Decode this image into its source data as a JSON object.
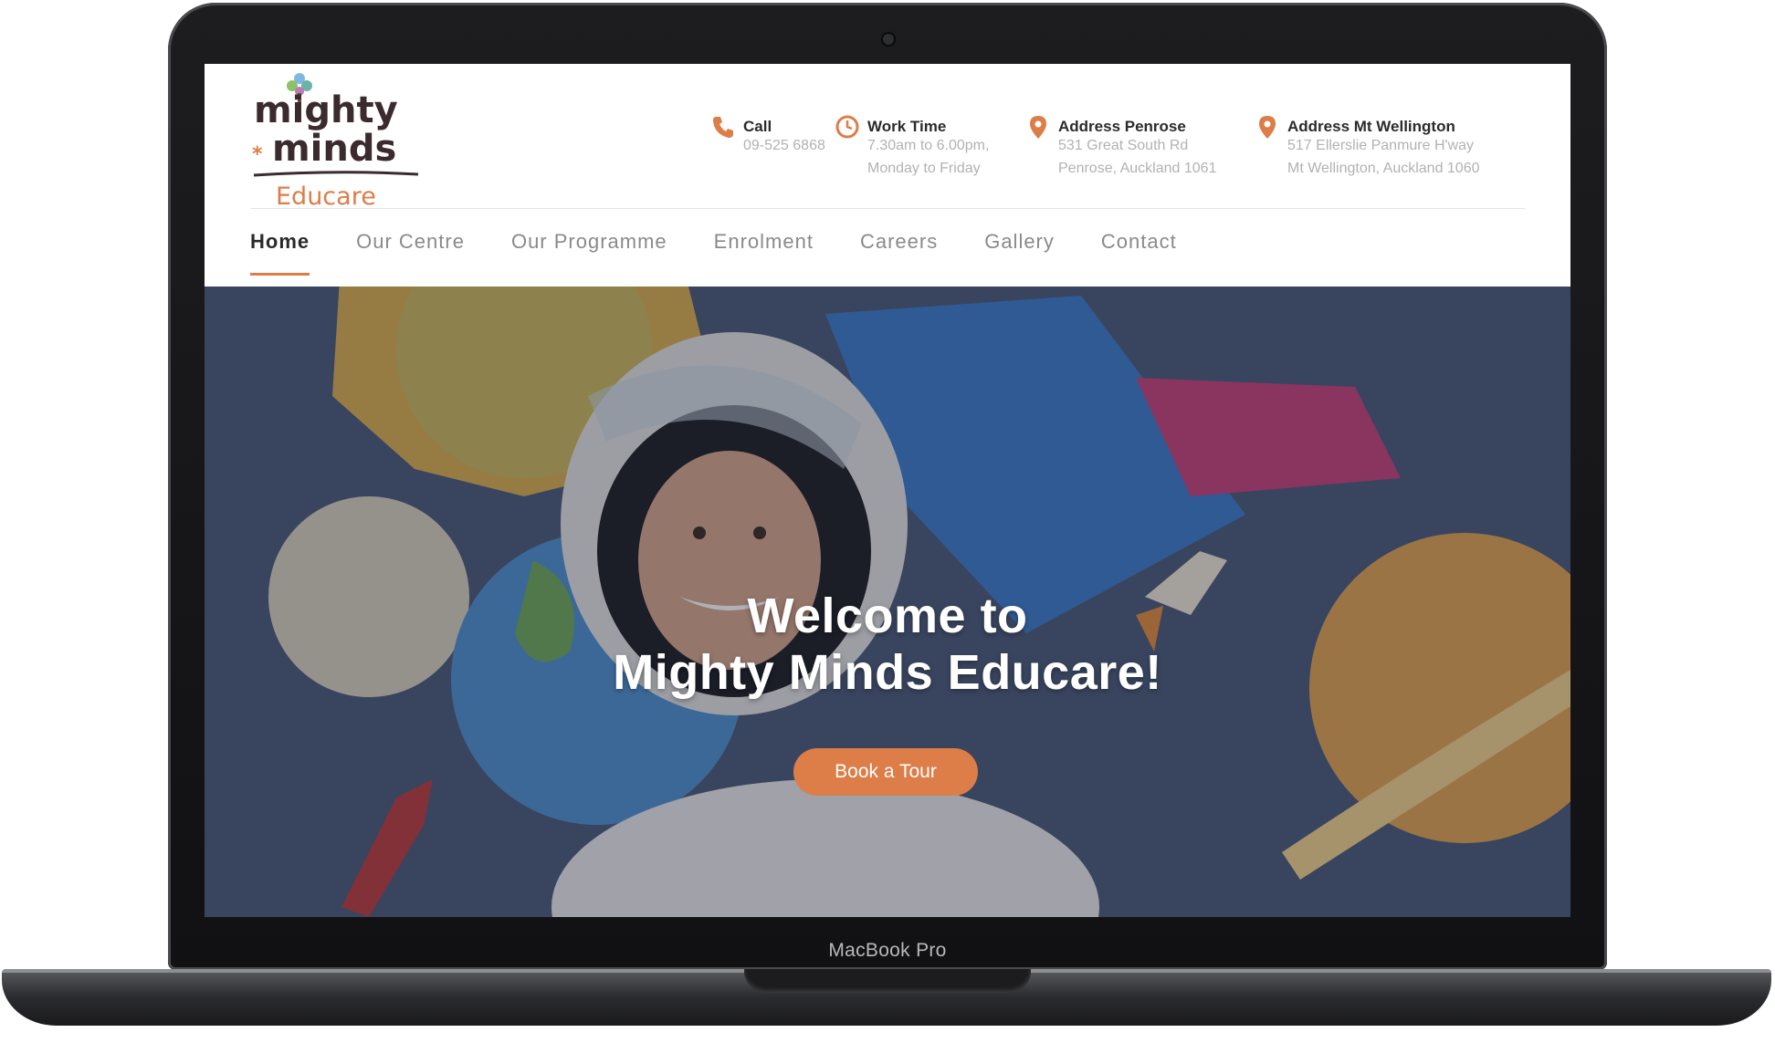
{
  "device": {
    "label": "MacBook Pro"
  },
  "logo": {
    "line1": "mighty",
    "line2": "minds",
    "line3": "Educare"
  },
  "header_info": [
    {
      "icon": "phone-icon",
      "title": "Call",
      "lines": [
        "09-525 6868"
      ]
    },
    {
      "icon": "clock-icon",
      "title": "Work Time",
      "lines": [
        "7.30am to 6.00pm,",
        "Monday to Friday"
      ]
    },
    {
      "icon": "location-pin-icon",
      "title": "Address Penrose",
      "lines": [
        "531 Great South Rd",
        "Penrose, Auckland 1061"
      ]
    },
    {
      "icon": "location-pin-icon",
      "title": "Address Mt Wellington",
      "lines": [
        "517 Ellerslie Panmure H'way",
        "Mt Wellington, Auckland 1060"
      ]
    }
  ],
  "nav": {
    "items": [
      "Home",
      "Our Centre",
      "Our Programme",
      "Enrolment",
      "Careers",
      "Gallery",
      "Contact"
    ],
    "active": "Home"
  },
  "hero": {
    "title_line1": "Welcome to",
    "title_line2": "Mighty Minds Educare!",
    "cta_label": "Book a Tour"
  },
  "colors": {
    "accent": "#dd7d48",
    "logo_text": "#3b2a2e",
    "nav_text": "#8a8a8a",
    "hero_bg": "#4a5a78"
  }
}
